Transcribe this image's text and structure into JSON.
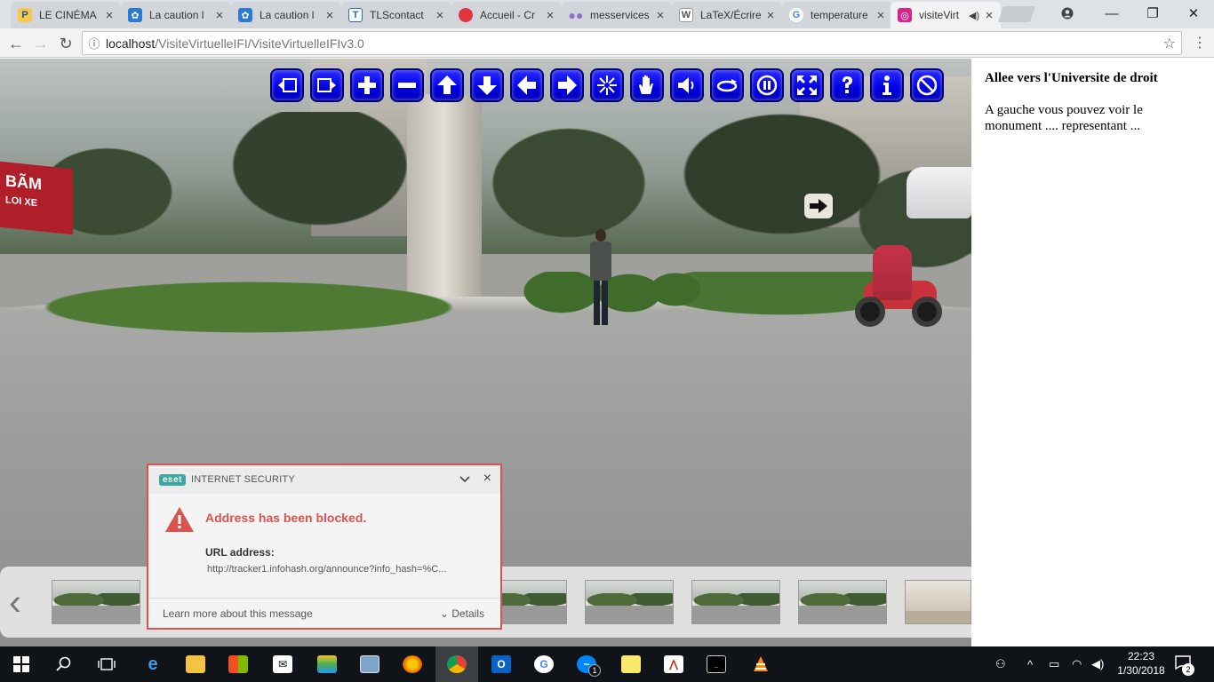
{
  "browser": {
    "tabs": [
      {
        "title": "LE CINÉMA",
        "icon": "p-app-icon",
        "color": "#f7c948"
      },
      {
        "title": "La caution l",
        "icon": "puzzle-icon",
        "color": "#2b7bd4"
      },
      {
        "title": "La caution l",
        "icon": "puzzle-icon",
        "color": "#2b7bd4"
      },
      {
        "title": "TLScontact",
        "icon": "tls-icon",
        "color": "#2a6cb0"
      },
      {
        "title": "Accueil - Cr",
        "icon": "red-circle-icon",
        "color": "#e0343f"
      },
      {
        "title": "messervices",
        "icon": "dots-icon",
        "color": "#8a6fcf"
      },
      {
        "title": "LaTeX/Écrire",
        "icon": "wiki-icon",
        "color": "#555555"
      },
      {
        "title": "temperature",
        "icon": "google-icon",
        "color": "#4285f4"
      },
      {
        "title": "visiteVirt",
        "icon": "app-pink-icon",
        "color": "#d6248b",
        "active": true
      }
    ],
    "url_host": "localhost",
    "url_path": "/VisiteVirtuelleIFI/VisiteVirtuelleIFIv3.0"
  },
  "viewer": {
    "controls": [
      "prev-view-icon",
      "next-view-icon",
      "zoom-in-icon",
      "zoom-out-icon",
      "arrow-up-icon",
      "arrow-down-icon",
      "arrow-left-icon",
      "arrow-right-icon",
      "autorotate-icon",
      "hand-icon",
      "sound-icon",
      "rotate-icon",
      "pause-icon",
      "fullscreen-icon",
      "help-icon",
      "info-icon",
      "hide-icon"
    ],
    "sign_text": "BÃM",
    "sign_sub": "LOI XE"
  },
  "side_panel": {
    "title": "Allee vers l'Universite de droit",
    "text": "A gauche vous pouvez voir le monument .... representant ..."
  },
  "eset": {
    "logo": "eset",
    "product": "INTERNET SECURITY",
    "title": "Address has been blocked.",
    "url_label": "URL address:",
    "url": "http://tracker1.infohash.org/announce?info_hash=%C...",
    "learn_more": "Learn more about this message",
    "details": "Details"
  },
  "taskbar": {
    "time": "22:23",
    "date": "1/30/2018",
    "notifications": "2",
    "messenger_badge": "1"
  }
}
